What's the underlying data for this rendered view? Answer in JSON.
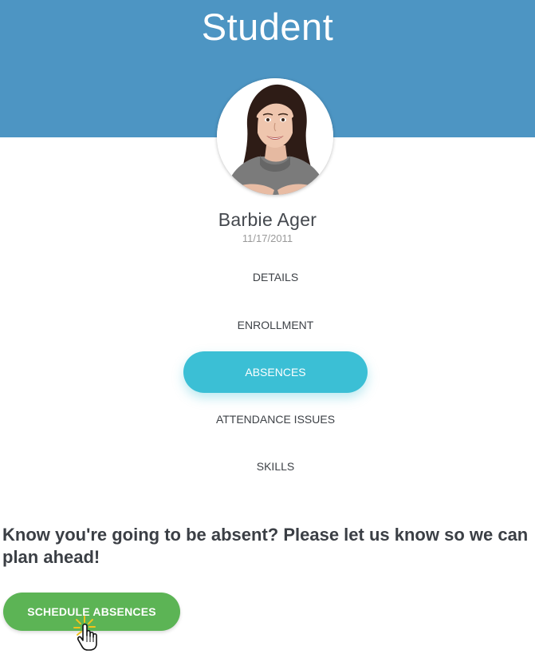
{
  "header": {
    "title": "Student",
    "background": "#4d95c3"
  },
  "student": {
    "name": "Barbie Ager",
    "dob": "11/17/2011"
  },
  "nav": {
    "items": [
      {
        "label": "DETAILS",
        "active": false
      },
      {
        "label": "ENROLLMENT",
        "active": false
      },
      {
        "label": "ABSENCES",
        "active": true
      },
      {
        "label": "ATTENDANCE ISSUES",
        "active": false
      },
      {
        "label": "SKILLS",
        "active": false
      }
    ],
    "active_color": "#3bbfd5"
  },
  "main": {
    "prompt": "Know you're going to be absent? Please let us know so we can plan ahead!",
    "schedule_button": "SCHEDULE ABSENCES",
    "button_color": "#5cb455"
  },
  "icons": {
    "avatar": "student-photo",
    "cursor": "hand-pointer-icon"
  }
}
